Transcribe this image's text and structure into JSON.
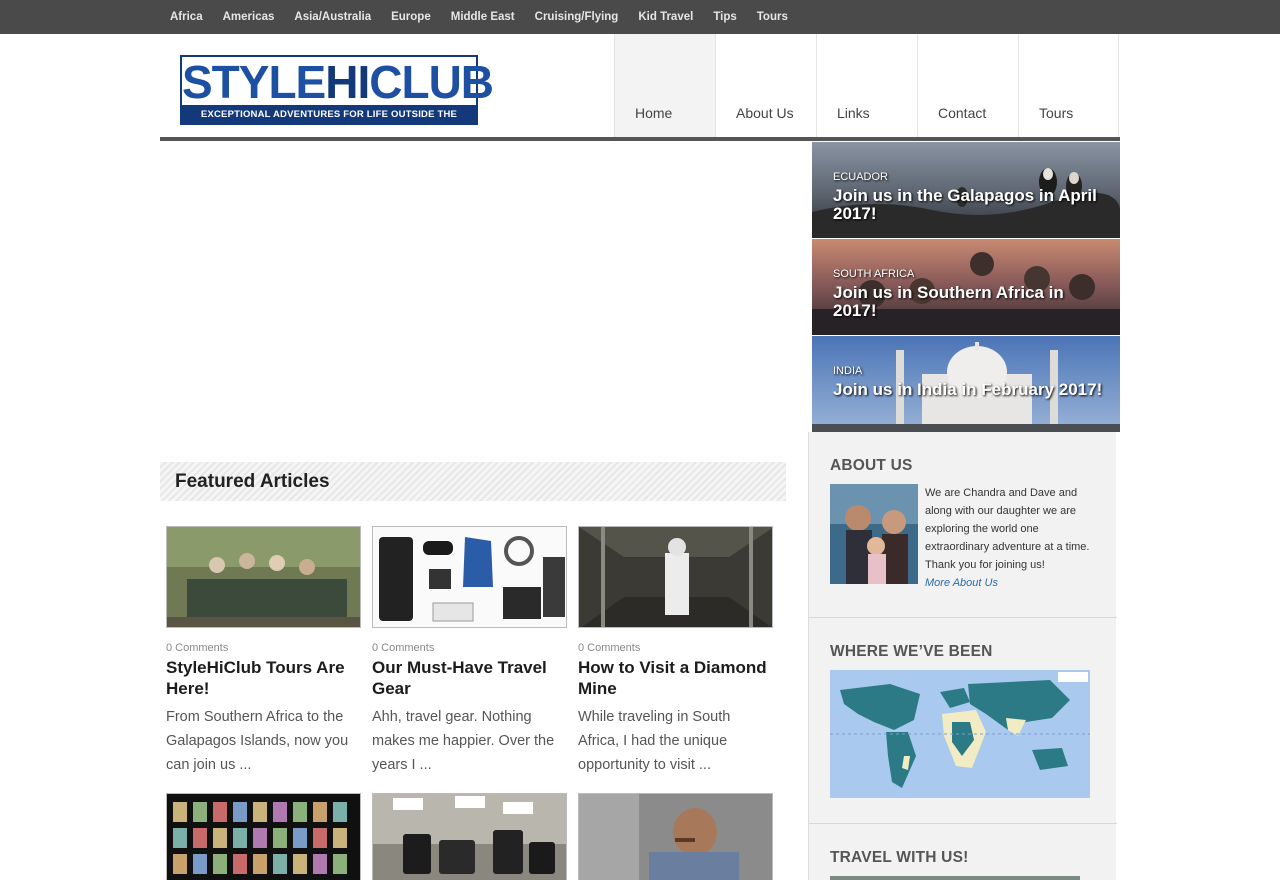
{
  "topnav": [
    "Africa",
    "Americas",
    "Asia/Australia",
    "Europe",
    "Middle East",
    "Cruising/Flying",
    "Kid Travel",
    "Tips",
    "Tours"
  ],
  "logo": {
    "brand_part1": "STYLE",
    "brand_part2": "HI",
    "brand_part3": "CLUB",
    "tagline": "EXCEPTIONAL ADVENTURES FOR LIFE OUTSIDE THE CUBICLE"
  },
  "mainnav": [
    "Home",
    "About Us",
    "Links",
    "Contact",
    "Tours"
  ],
  "promos": [
    {
      "kicker": "ECUADOR",
      "headline": "Join us in the Galapagos in April 2017!"
    },
    {
      "kicker": "SOUTH AFRICA",
      "headline": "Join us in Southern Africa in 2017!"
    },
    {
      "kicker": "INDIA",
      "headline": "Join us in India in February 2017!"
    }
  ],
  "featured": {
    "heading": "Featured Articles",
    "cards": [
      {
        "comments": "0 Comments",
        "title": "StyleHiClub Tours Are Here!",
        "excerpt": "From Southern Africa to the Galapagos Islands, now you can join us ..."
      },
      {
        "comments": "0 Comments",
        "title": "Our Must-Have Travel Gear",
        "excerpt": "  Ahh, travel gear.  Nothing makes me happier.  Over the years I ..."
      },
      {
        "comments": "0 Comments",
        "title": "How to Visit a Diamond Mine",
        "excerpt": "While traveling in South Africa, I had the unique opportunity to visit ..."
      }
    ]
  },
  "sidebar": {
    "about_title": "ABOUT US",
    "about_text": "We are Chandra and Dave and along with our daughter we are exploring the world one extraordinary adventure at a time. Thank you for joining us!",
    "about_more": "More About Us",
    "where_title": "WHERE WE’VE BEEN",
    "travel_title": "TRAVEL WITH US!"
  },
  "colors": {
    "topbar": "#4a4a4a",
    "brand_blue": "#14397a",
    "link_blue": "#2a6aa8",
    "sidebar_bg": "#f2f2f2"
  }
}
